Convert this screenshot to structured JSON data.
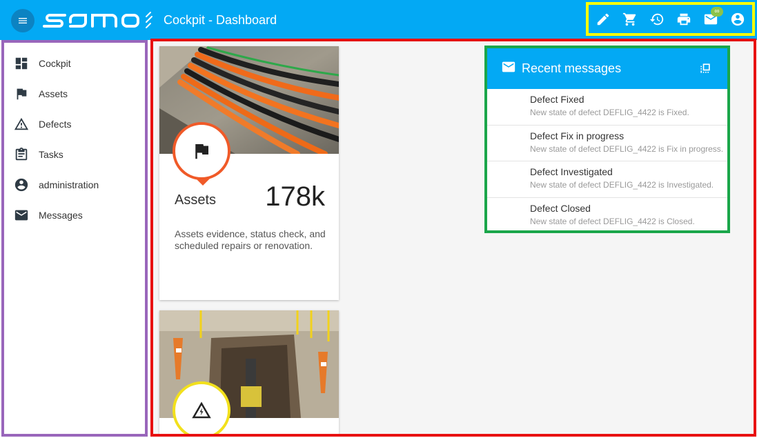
{
  "header": {
    "logo_text": "samo",
    "title": "Cockpit - Dashboard",
    "actions": [
      {
        "icon": "pencil-icon"
      },
      {
        "icon": "cart-icon"
      },
      {
        "icon": "history-icon"
      },
      {
        "icon": "printer-icon"
      },
      {
        "icon": "mail-icon",
        "badge": "∞"
      },
      {
        "icon": "account-circle-icon"
      }
    ],
    "colors": {
      "primary": "#03a9f4",
      "badge": "#8bc34a"
    }
  },
  "sidebar": {
    "items": [
      {
        "label": "Cockpit",
        "icon": "dashboard-icon"
      },
      {
        "label": "Assets",
        "icon": "flag-icon"
      },
      {
        "label": "Defects",
        "icon": "warning-triangle-icon"
      },
      {
        "label": "Tasks",
        "icon": "clipboard-icon"
      },
      {
        "label": "administration",
        "icon": "account-circle-icon"
      },
      {
        "label": "Messages",
        "icon": "mail-icon"
      }
    ]
  },
  "cards": [
    {
      "title": "Assets",
      "value": "178k",
      "description": "Assets evidence, status check, and scheduled repairs or renovation.",
      "icon": "flag-icon",
      "accent": "#f05a28"
    },
    {
      "icon": "warning-triangle-icon",
      "accent": "#f2e01c"
    }
  ],
  "messages": {
    "title": "Recent messages",
    "items": [
      {
        "title": "Defect Fixed",
        "body": "New state of defect DEFLIG_4422 is Fixed."
      },
      {
        "title": "Defect Fix in progress",
        "body": "New state of defect DEFLIG_4422 is Fix in progress."
      },
      {
        "title": "Defect Investigated",
        "body": "New state of defect DEFLIG_4422 is Investigated."
      },
      {
        "title": "Defect Closed",
        "body": "New state of defect DEFLIG_4422 is Closed."
      }
    ]
  }
}
